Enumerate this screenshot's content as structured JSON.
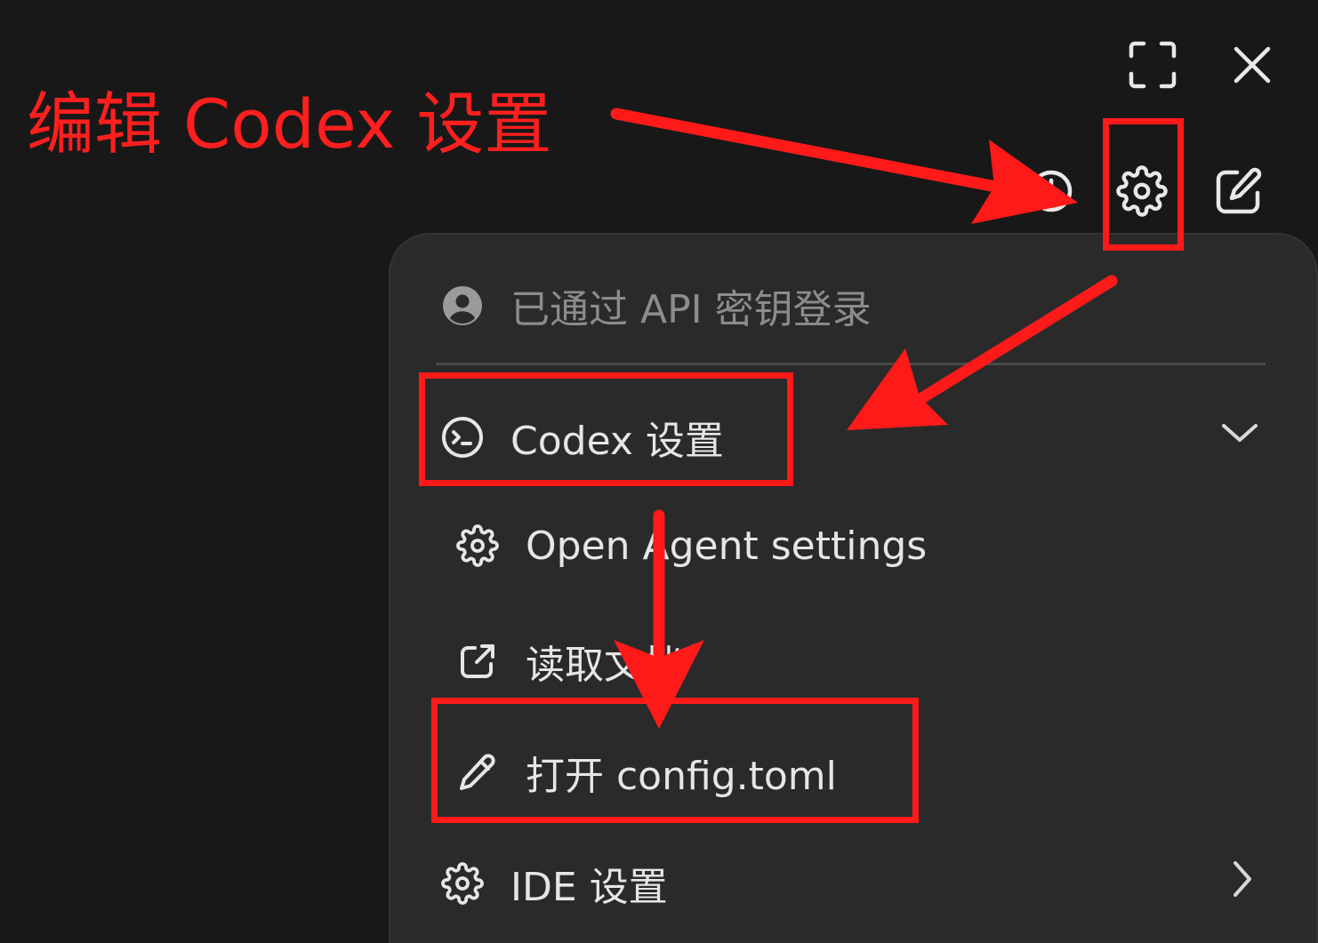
{
  "annotation": {
    "title": "编辑 Codex 设置",
    "color": "#ff1a1a"
  },
  "window_controls": {
    "fullscreen_icon": "fullscreen-icon",
    "close_icon": "close-icon"
  },
  "toolbar": {
    "history_icon": "history-icon",
    "settings_icon": "gear-icon",
    "new_chat_icon": "edit-icon"
  },
  "menu": {
    "account": {
      "icon": "user-circle-icon",
      "label": "已通过 API 密钥登录"
    },
    "codex_settings": {
      "icon": "terminal-icon",
      "label": "Codex 设置",
      "expander_icon": "chevron-down-icon"
    },
    "open_agent_settings": {
      "icon": "gear-icon",
      "label": "Open Agent settings"
    },
    "read_docs": {
      "icon": "external-link-icon",
      "label": "读取文档"
    },
    "open_config": {
      "icon": "pencil-icon",
      "label": "打开 config.toml"
    },
    "ide_settings": {
      "icon": "gear-icon",
      "label": "IDE 设置",
      "expander_icon": "chevron-right-icon"
    }
  }
}
